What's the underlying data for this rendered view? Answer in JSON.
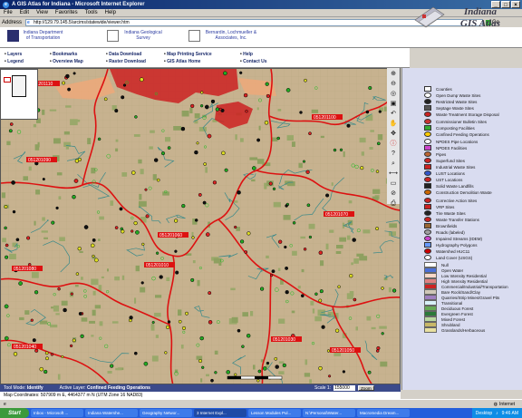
{
  "window": {
    "title": "A GIS Atlas for Indiana - Microsoft Internet Explorer",
    "controls": [
      "_",
      "□",
      "×"
    ]
  },
  "menu": [
    "File",
    "Edit",
    "View",
    "Favorites",
    "Tools",
    "Help"
  ],
  "address": {
    "label": "Address",
    "url": "http://129.79.145.5/arcims/statewide/viewer.htm",
    "go_label": "Go"
  },
  "header": {
    "logos": [
      "Indiana Department of Transportation",
      "Indiana Geological Survey",
      "Bernardin, Lochmueller & Associates, Inc."
    ],
    "atlas_title_line1": "Indiana",
    "atlas_title_line2": "GIS Atlas"
  },
  "nav": {
    "row1": [
      "Layers",
      "Bookmarks",
      "Data Download",
      "Map Printing Service",
      "Help"
    ],
    "row2": [
      "Legend",
      "Overview Map",
      "Raster Download",
      "GIS Atlas Home",
      "Contact Us"
    ]
  },
  "map": {
    "watershed_labels": [
      "051201110",
      "051201100",
      "051201090",
      "051201060",
      "051201070",
      "051201080",
      "051201010",
      "051201040",
      "051201030",
      "051201050",
      "051201020"
    ]
  },
  "legend": {
    "items": [
      {
        "label": "Counties",
        "color": "#ffffff"
      },
      {
        "label": "Open Dump Waste Sites",
        "color": "#ffffff"
      },
      {
        "label": "Restricted Waste Sites",
        "color": "#222222"
      },
      {
        "label": "Septage Waste Sites",
        "color": "#555555"
      },
      {
        "label": "Waste Treatment Storage Disposal",
        "color": "#cc2222"
      },
      {
        "label": "Commissioner Bulletin Sites",
        "color": "#cc3333"
      },
      {
        "label": "Composting Facilities",
        "color": "#33aa33"
      },
      {
        "label": "Confined Feeding Operations",
        "color": "#ffcc00"
      },
      {
        "label": "NPDES Pipe Locations",
        "color": "#ffffff"
      },
      {
        "label": "NPDES Facilities",
        "color": "#cc44cc"
      },
      {
        "label": "Pipes",
        "color": "#bb6633"
      },
      {
        "label": "Superfund Sites",
        "color": "#cc2222"
      },
      {
        "label": "Industrial Waste Sites",
        "color": "#cc2222"
      },
      {
        "label": "LUST Locations",
        "color": "#3355cc"
      },
      {
        "label": "UST Locations",
        "color": "#cc2222"
      },
      {
        "label": "Solid Waste Landfills",
        "color": "#222222"
      },
      {
        "label": "Construction Demolition Waste",
        "color": "#cc6600"
      },
      {
        "label": "Corrective Action Sites",
        "color": "#cc2222"
      },
      {
        "label": "VRP Sites",
        "color": "#cc2222"
      },
      {
        "label": "Tire Waste Sites",
        "color": "#222222"
      },
      {
        "label": "Waste Transfer Stations",
        "color": "#cc2222"
      },
      {
        "label": "Brownfields",
        "color": "#996633"
      },
      {
        "label": "Roads (labeled)",
        "color": "#a0a0a0"
      },
      {
        "label": "Impaired Streams (IDEM)",
        "color": "#cc44cc"
      },
      {
        "label": "Hydrography Polygons",
        "color": "#6699ff"
      },
      {
        "label": "Watershed HUC11",
        "color": "#cc0000"
      },
      {
        "label": "Land Cover (USGS)",
        "color": "#ffffff"
      },
      {
        "label": "Null",
        "color": "#ffffff"
      },
      {
        "label": "Open Water",
        "color": "#4a6fd8"
      },
      {
        "label": "Low Intensity Residential",
        "color": "#f8d8c8"
      },
      {
        "label": "High Intensity Residential",
        "color": "#e08080"
      },
      {
        "label": "Commercial/Industrial/Transportation",
        "color": "#cc2222"
      },
      {
        "label": "Bare Rock/Sand/Clay",
        "color": "#d0c8b8"
      },
      {
        "label": "Quarries/Strip Mines/Gravel Pits",
        "color": "#a080c0"
      },
      {
        "label": "Transitional",
        "color": "#d8f0f8"
      },
      {
        "label": "Deciduous Forest",
        "color": "#66aa55"
      },
      {
        "label": "Evergreen Forest",
        "color": "#2a7a3a"
      },
      {
        "label": "Mixed Forest",
        "color": "#b8d8a0"
      },
      {
        "label": "Shrubland",
        "color": "#c8b868"
      },
      {
        "label": "Grasslands/Herbaceous",
        "color": "#e8e0a0"
      }
    ]
  },
  "status": {
    "tool_mode_label": "Tool Mode:",
    "tool_mode_value": "Identify",
    "active_layer_label": "Active Layer:",
    "active_layer_value": "Confined Feeding Operations",
    "scale_label": "Scale 1:",
    "scale_value": "155000",
    "zoom_label": "Zoom",
    "coordinates": "Map Coordinates: 507909 m E, 4464377 m N (UTM Zone 16 NAD83)"
  },
  "ie_status": {
    "zone": "Internet"
  },
  "taskbar": {
    "start": "Start",
    "buttons": [
      "Inbox - Microsoft ...",
      "Indiana Watershe...",
      "Geography Networ...",
      "3 Internet Expl...",
      "Lesson Modules Pul...",
      "N:\\Personal\\Water...",
      "Macromedia Dream..."
    ],
    "active_index": 3,
    "desktop": "Desktop",
    "clock": "9:46 AM"
  },
  "colors": {
    "map_ground": "#c7b28f",
    "watershed_line": "#dd1111",
    "stream": "#3a8a8a",
    "title_bar": "#0a246a",
    "legend_bg": "#d9dcf0",
    "status_bar": "#3b4a8a",
    "taskbar": "#245edb"
  }
}
